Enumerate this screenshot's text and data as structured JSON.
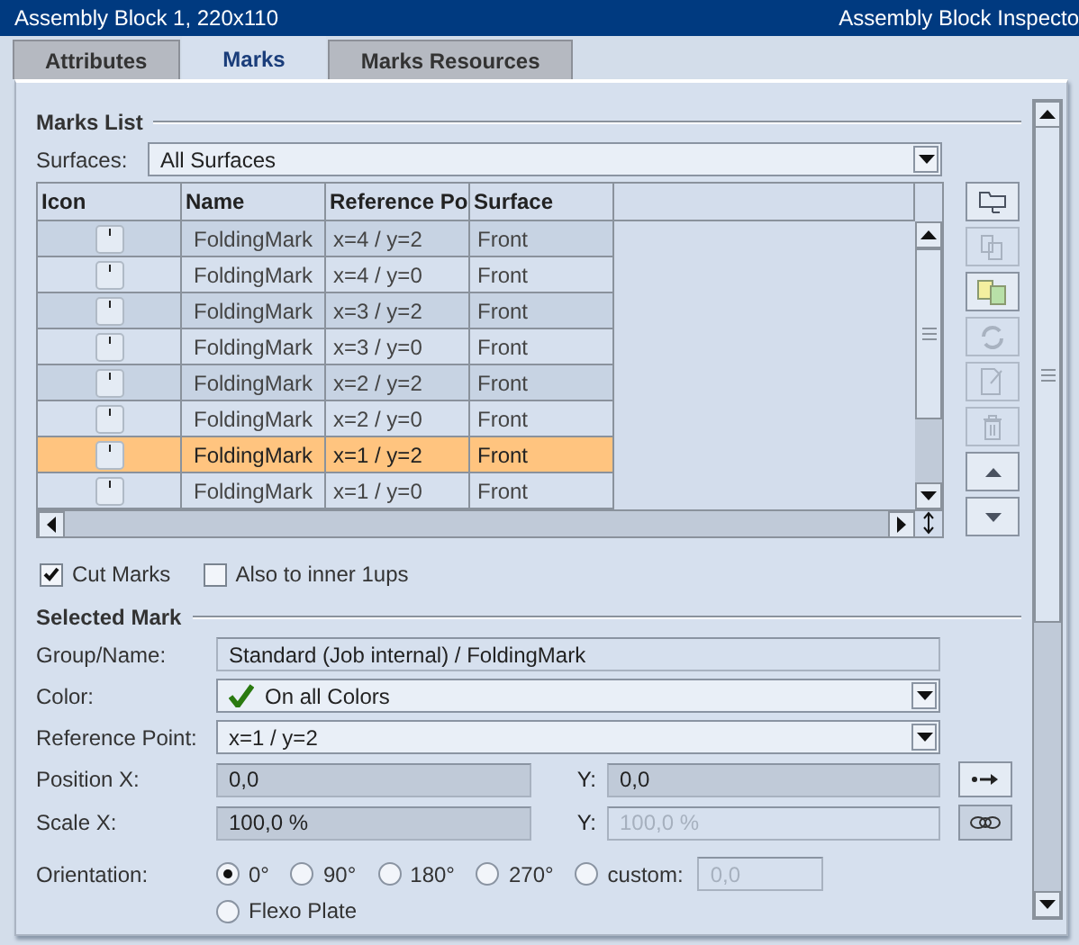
{
  "title_bar": {
    "title": "Assembly Block 1, 220x110",
    "inspector": "Assembly Block Inspecto"
  },
  "tabs": [
    {
      "label": "Attributes",
      "selected": false
    },
    {
      "label": "Marks",
      "selected": true
    },
    {
      "label": "Marks Resources",
      "selected": false
    }
  ],
  "marks_list": {
    "title": "Marks List",
    "surfaces_label": "Surfaces:",
    "surfaces_value": "All Surfaces",
    "table": {
      "columns": [
        "Icon",
        "Name",
        "Reference Po",
        "Surface"
      ],
      "rows": [
        {
          "name": "FoldingMark",
          "reference": "x=4 / y=2",
          "surface": "Front",
          "selected": false
        },
        {
          "name": "FoldingMark",
          "reference": "x=4 / y=0",
          "surface": "Front",
          "selected": false
        },
        {
          "name": "FoldingMark",
          "reference": "x=3 / y=2",
          "surface": "Front",
          "selected": false
        },
        {
          "name": "FoldingMark",
          "reference": "x=3 / y=0",
          "surface": "Front",
          "selected": false
        },
        {
          "name": "FoldingMark",
          "reference": "x=2 / y=2",
          "surface": "Front",
          "selected": false
        },
        {
          "name": "FoldingMark",
          "reference": "x=2 / y=0",
          "surface": "Front",
          "selected": false
        },
        {
          "name": "FoldingMark",
          "reference": "x=1 / y=2",
          "surface": "Front",
          "selected": true
        },
        {
          "name": "FoldingMark",
          "reference": "x=1 / y=0",
          "surface": "Front",
          "selected": false
        }
      ]
    },
    "side_buttons": [
      {
        "kind": "new",
        "disabled": false
      },
      {
        "kind": "copy",
        "disabled": true
      },
      {
        "kind": "duplicate",
        "disabled": false
      },
      {
        "kind": "replace",
        "disabled": true
      },
      {
        "kind": "edit",
        "disabled": true
      },
      {
        "kind": "delete",
        "disabled": true
      },
      {
        "kind": "up",
        "disabled": false
      },
      {
        "kind": "down",
        "disabled": false
      }
    ],
    "checkboxes": [
      {
        "label": "Cut Marks",
        "checked": true
      },
      {
        "label": "Also to inner 1ups",
        "checked": false
      }
    ]
  },
  "selected_mark": {
    "title": "Selected Mark",
    "group_name": {
      "label": "Group/Name:",
      "value": "Standard (Job internal) / FoldingMark"
    },
    "color": {
      "label": "Color:",
      "value": "On all Colors"
    },
    "reference_point": {
      "label": "Reference Point:",
      "value": "x=1 / y=2"
    },
    "position": {
      "label": "Position X:",
      "x_value": "0,0",
      "y_label": "Y:",
      "y_value": "0,0"
    },
    "scale": {
      "label": "Scale X:",
      "x_value": "100,0 %",
      "y_label": "Y:",
      "y_value": "100,0 %",
      "y_disabled": true
    },
    "orientation": {
      "label": "Orientation:",
      "options": [
        {
          "label": "0°",
          "selected": true
        },
        {
          "label": "90°",
          "selected": false
        },
        {
          "label": "180°",
          "selected": false
        },
        {
          "label": "270°",
          "selected": false
        },
        {
          "label": "custom:",
          "selected": false
        }
      ],
      "custom_value": "0,0"
    },
    "flexo_plate": {
      "label": "Flexo Plate",
      "selected": false
    }
  }
}
